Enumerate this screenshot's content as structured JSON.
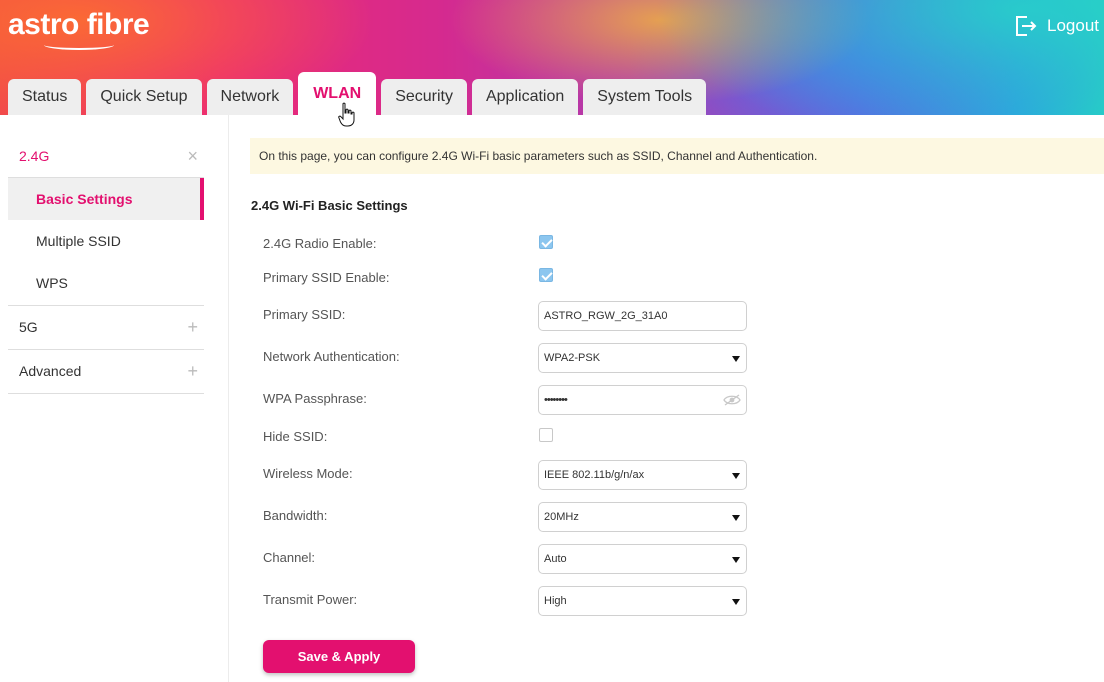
{
  "header": {
    "logo": "astro fibre",
    "logout_label": "Logout",
    "tabs": [
      {
        "label": "Status"
      },
      {
        "label": "Quick Setup"
      },
      {
        "label": "Network"
      },
      {
        "label": "WLAN"
      },
      {
        "label": "Security"
      },
      {
        "label": "Application"
      },
      {
        "label": "System Tools"
      }
    ],
    "active_tab": "WLAN"
  },
  "sidebar": {
    "groups": [
      {
        "label": "2.4G",
        "control": "×",
        "expanded": true
      },
      {
        "label": "5G",
        "control": "+",
        "expanded": false
      },
      {
        "label": "Advanced",
        "control": "+",
        "expanded": false
      }
    ],
    "items_2_4g": [
      {
        "label": "Basic Settings",
        "selected": true
      },
      {
        "label": "Multiple SSID"
      },
      {
        "label": "WPS"
      }
    ]
  },
  "main": {
    "notice": "On this page, you can configure 2.4G Wi-Fi basic parameters such as SSID, Channel and Authentication.",
    "section_title": "2.4G Wi-Fi Basic Settings",
    "fields": {
      "radio_enable": {
        "label": "2.4G Radio Enable:",
        "checked": true
      },
      "primary_ssid_enable": {
        "label": "Primary SSID Enable:",
        "checked": true
      },
      "primary_ssid": {
        "label": "Primary SSID:",
        "value": "ASTRO_RGW_2G_31A0"
      },
      "network_auth": {
        "label": "Network Authentication:",
        "value": "WPA2-PSK"
      },
      "wpa_passphrase": {
        "label": "WPA Passphrase:",
        "value": "••••••••"
      },
      "hide_ssid": {
        "label": "Hide SSID:",
        "checked": false
      },
      "wireless_mode": {
        "label": "Wireless Mode:",
        "value": "IEEE 802.11b/g/n/ax"
      },
      "bandwidth": {
        "label": "Bandwidth:",
        "value": "20MHz"
      },
      "channel": {
        "label": "Channel:",
        "value": "Auto"
      },
      "transmit_power": {
        "label": "Transmit Power:",
        "value": "High"
      }
    },
    "save_label": "Save & Apply"
  },
  "colors": {
    "accent": "#e3106f",
    "notice_bg": "#fdf8e1",
    "checkbox_checked": "#8cc6ef"
  }
}
